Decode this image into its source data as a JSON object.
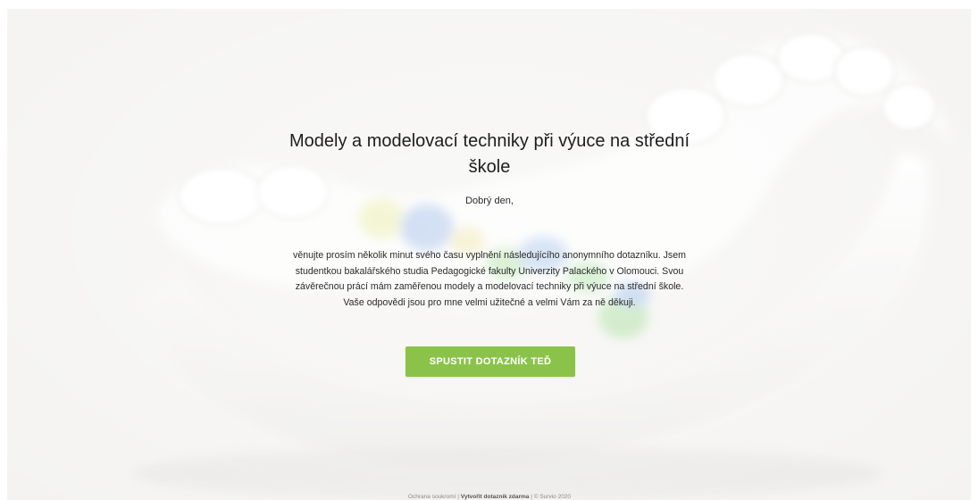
{
  "survey": {
    "title": "Modely a modelovací techniky při výuce na střední škole",
    "greeting": "Dobrý den,",
    "intro": "věnujte prosím několik minut svého času vyplnění následujícího anonymního dotazníku. Jsem studentkou bakalářského studia Pedagogické fakulty Univerzity Palackého v Olomouci. Svou závěrečnou prácí mám zaměřenou modely a modelovací techniky při výuce na střední škole. Vaše odpovědi jsou pro mne velmi užitečné a velmi Vám za ně děkuji.",
    "start_label": "SPUSTIT DOTAZNÍK TEĎ"
  },
  "footer": {
    "privacy": "Ochrana soukromí",
    "create": "Vytvořit dotazník zdarma",
    "copyright": "© Survio 2020"
  },
  "colors": {
    "accent": "#8bc34a",
    "background": "#f3f2f0",
    "text": "#1e1e1e"
  }
}
